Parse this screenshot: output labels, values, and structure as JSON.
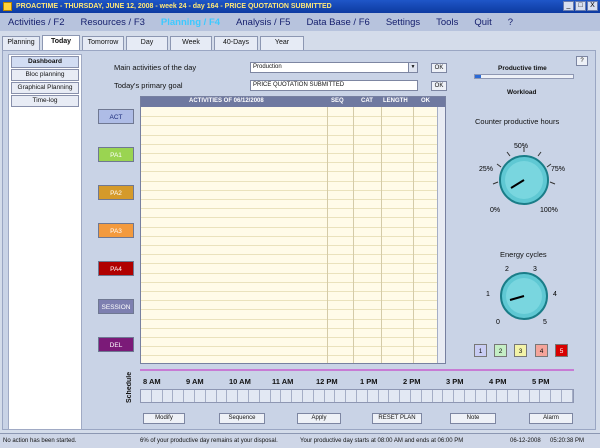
{
  "titlebar": {
    "text": "PROACTIME - THURSDAY, JUNE 12, 2008 - week 24 - day 164 - PRICE QUOTATION SUBMITTED",
    "buttons": [
      "_",
      "□",
      "X"
    ]
  },
  "menu": [
    "Activities / F2",
    "Resources / F3",
    "Planning / F4",
    "Analysis / F5",
    "Data Base / F6",
    "Settings",
    "Tools",
    "Quit",
    "?"
  ],
  "tabs": [
    "Planning",
    "Today",
    "Tomorrow",
    "Day",
    "Week",
    "40-Days",
    "Year"
  ],
  "sidebar": [
    "Dashboard",
    "Bloc planning",
    "Graphical Planning",
    "Time-log"
  ],
  "form": {
    "main_activities_label": "Main activities of the day",
    "main_activities_value": "Production",
    "primary_goal_label": "Today's primary goal",
    "primary_goal_value": "PRICE QUOTATION SUBMITTED",
    "ok": "OK"
  },
  "categories": [
    {
      "label": "ACT",
      "color": "#aebce6",
      "text": "#1a2a7a"
    },
    {
      "label": "PA1",
      "color": "#9ad451",
      "text": "#ffffff"
    },
    {
      "label": "PA2",
      "color": "#d59a2a",
      "text": "#ffffff"
    },
    {
      "label": "PA3",
      "color": "#f39a3e",
      "text": "#ffffff"
    },
    {
      "label": "PA4",
      "color": "#b00000",
      "text": "#ffffff"
    },
    {
      "label": "SESSION",
      "color": "#7d7fb0",
      "text": "#ffffff"
    },
    {
      "label": "DEL",
      "color": "#7b1a78",
      "text": "#ffffff"
    }
  ],
  "table": {
    "headers": [
      "ACTIVITIES OF 06/12/2008",
      "SEQ",
      "CAT",
      "LENGTH",
      "OK"
    ]
  },
  "productive": {
    "title": "Productive time",
    "workload": "Workload",
    "counter_title": "Counter productive hours",
    "counter_ticks": [
      "0%",
      "25%",
      "50%",
      "75%",
      "100%"
    ],
    "energy_title": "Energy cycles",
    "energy_ticks": [
      "0",
      "1",
      "2",
      "3",
      "4",
      "5"
    ],
    "energy_buttons": [
      {
        "label": "1",
        "color": "#c9cdf4"
      },
      {
        "label": "2",
        "color": "#c5eec5"
      },
      {
        "label": "3",
        "color": "#f3f3a8"
      },
      {
        "label": "4",
        "color": "#f4a49a"
      },
      {
        "label": "5",
        "color": "#d80000"
      }
    ],
    "help": "?"
  },
  "schedule": {
    "label": "Schedule",
    "hours": [
      "8 AM",
      "9 AM",
      "10 AM",
      "11 AM",
      "12 PM",
      "1 PM",
      "2 PM",
      "3 PM",
      "4 PM",
      "5 PM"
    ]
  },
  "buttons": [
    "Modify",
    "Sequence",
    "Apply",
    "RESET PLAN",
    "Note",
    "Alarm"
  ],
  "status": {
    "left": "No action has been started.",
    "mid1": "6% of your productive day remains at your disposal.",
    "mid2": "Your productive day starts at 08:00 AM and ends at 06:00 PM",
    "date": "06-12-2008",
    "time": "05:20:38 PM"
  }
}
